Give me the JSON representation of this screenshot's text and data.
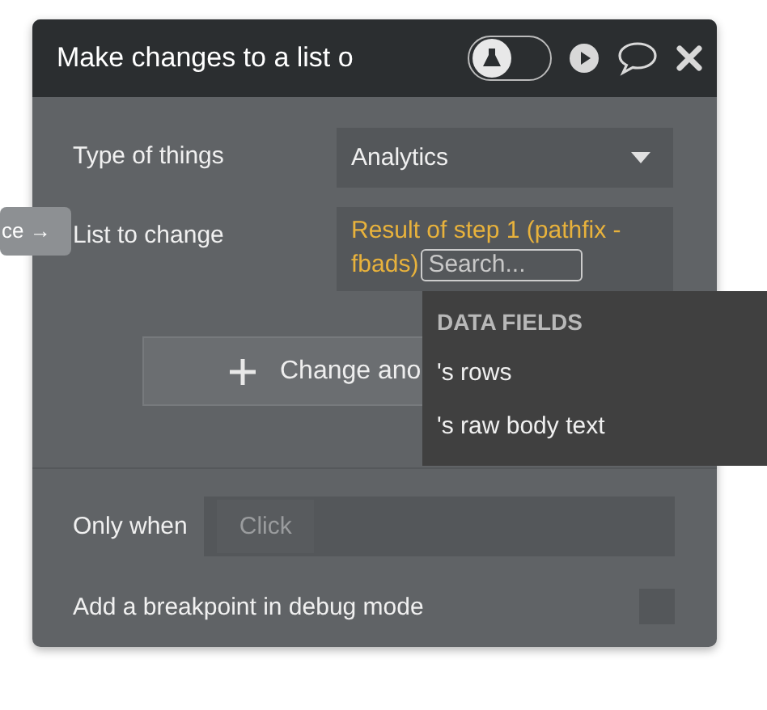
{
  "panel": {
    "title": "Make changes to a list o",
    "debug_toggle": {
      "on": false
    },
    "fields": [
      {
        "label": "Type of things",
        "kind": "dropdown",
        "value": "Analytics"
      },
      {
        "label": "List to change",
        "kind": "expression",
        "value_lines": [
          "Result of step 1 (pathfix -",
          "fbads)"
        ],
        "search_placeholder": "Search..."
      }
    ],
    "add_button": "Change ano",
    "only_when": {
      "label": "Only when",
      "placeholder": "Click"
    },
    "breakpoint": {
      "label": "Add a breakpoint in debug mode",
      "checked": false
    }
  },
  "dropdown_menu": {
    "heading": "DATA FIELDS",
    "items": [
      {
        "label": "'s rows",
        "selected": false
      },
      {
        "label": "'s raw body text",
        "selected": false
      }
    ]
  },
  "canvas_tag": "ce →"
}
